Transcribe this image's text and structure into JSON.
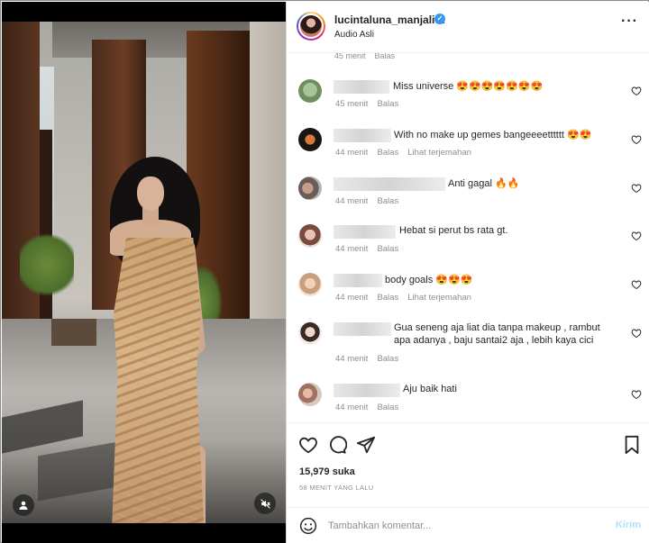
{
  "post": {
    "username": "lucintaluna_manjalita",
    "audio": "Audio Asli",
    "likes": "15,979 suka",
    "time": "58 MENIT YANG LALU"
  },
  "comments_top_clipped": {
    "time": "45 menit",
    "reply": "Balas"
  },
  "comments": [
    {
      "text": "Miss universe 😍😍😍😍😍😍😍",
      "time": "45 menit",
      "reply": "Balas",
      "translate": ""
    },
    {
      "text": "With no make up gemes bangeeeetttttt 😍😍",
      "time": "44 menit",
      "reply": "Balas",
      "translate": "Lihat terjemahan"
    },
    {
      "text": "Anti gagal 🔥🔥",
      "time": "44 menit",
      "reply": "Balas",
      "translate": ""
    },
    {
      "text": "Hebat si perut bs rata gt.",
      "time": "44 menit",
      "reply": "Balas",
      "translate": ""
    },
    {
      "text": "body goals 😍😍😍",
      "time": "44 menit",
      "reply": "Balas",
      "translate": "Lihat terjemahan"
    },
    {
      "text": "Gua seneng aja liat dia tanpa makeup , rambut apa adanya , baju santai2 aja , lebih kaya cici",
      "time": "44 menit",
      "reply": "Balas",
      "translate": ""
    },
    {
      "text": "Aju baik hati",
      "time": "44 menit",
      "reply": "Balas",
      "translate": ""
    }
  ],
  "composer": {
    "placeholder": "Tambahkan komentar...",
    "post_label": "Kirim"
  },
  "icons": {
    "more": "more-options-icon",
    "like": "heart-icon",
    "comment": "comment-icon",
    "share": "paper-plane-icon",
    "save": "bookmark-icon",
    "emoji": "emoji-icon",
    "user": "user-tag-icon",
    "mute": "muted-speaker-icon",
    "verified": "verified-badge-icon"
  },
  "colors": {
    "verified": "#3897f0",
    "post_button": "#b2dffc",
    "muted_text": "#8e8e8e"
  }
}
